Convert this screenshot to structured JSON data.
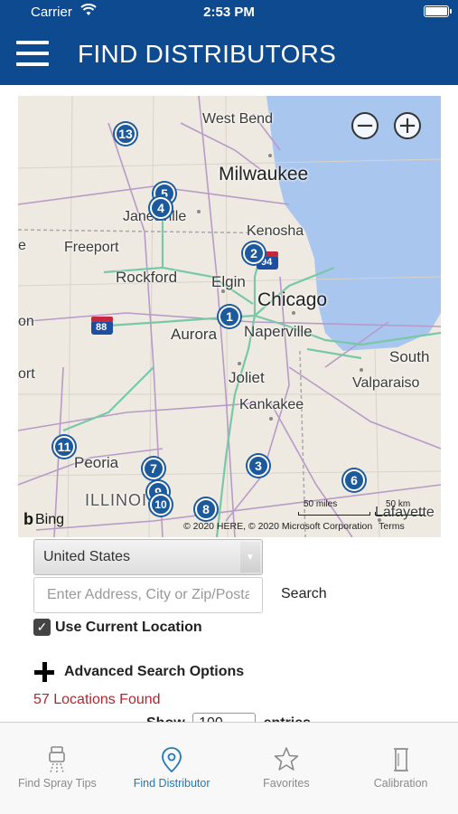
{
  "status_bar": {
    "carrier": "Carrier",
    "time": "2:53 PM"
  },
  "header": {
    "title": "FIND DISTRIBUTORS"
  },
  "map": {
    "labels": {
      "west_bend": "West Bend",
      "milwaukee": "Milwaukee",
      "janesville": "Janesville",
      "kenosha": "Kenosha",
      "freeport": "Freeport",
      "rockford": "Rockford",
      "elgin": "Elgin",
      "chicago": "Chicago",
      "aurora": "Aurora",
      "naperville": "Naperville",
      "south": "South",
      "joliet": "Joliet",
      "valparaiso": "Valparaiso",
      "kankakee": "Kankakee",
      "peoria": "Peoria",
      "illinois": "ILLINOIS",
      "lafayette": "Lafayette",
      "hwy_94": "94",
      "hwy_88": "88",
      "edge_e": "e",
      "edge_on": "on",
      "edge_ort": "ort"
    },
    "pins": [
      "13",
      "5",
      "4",
      "2",
      "1",
      "11",
      "7",
      "9",
      "10",
      "3",
      "8",
      "6"
    ],
    "scale_miles": "50 miles",
    "scale_km": "50 km",
    "bing": "Bing",
    "copyright": "© 2020 HERE, © 2020 Microsoft Corporation",
    "terms": "Terms",
    "zoom_out": "−",
    "zoom_in": "+",
    "colors": {
      "water": "#a9c6ee",
      "land": "#eeeae1",
      "highway": "#78c8a8",
      "road": "#b89ac8",
      "pin": "#1c5a9c"
    }
  },
  "form": {
    "country": "United States",
    "address_placeholder": "Enter Address, City or Zip/Postal Code",
    "search_label": "Search",
    "use_current_location_label": "Use Current Location",
    "use_current_location_checked": true,
    "advanced_label": "Advanced Search Options",
    "results_found": "57 Locations Found",
    "show_label": "Show",
    "show_value": "100",
    "entries_label": "entries"
  },
  "tabs": [
    {
      "label": "Find Spray Tips",
      "icon": "spray-gun-icon",
      "active": false
    },
    {
      "label": "Find Distributor",
      "icon": "location-pin-icon",
      "active": true
    },
    {
      "label": "Favorites",
      "icon": "star-icon",
      "active": false
    },
    {
      "label": "Calibration",
      "icon": "calibration-icon",
      "active": false
    }
  ]
}
